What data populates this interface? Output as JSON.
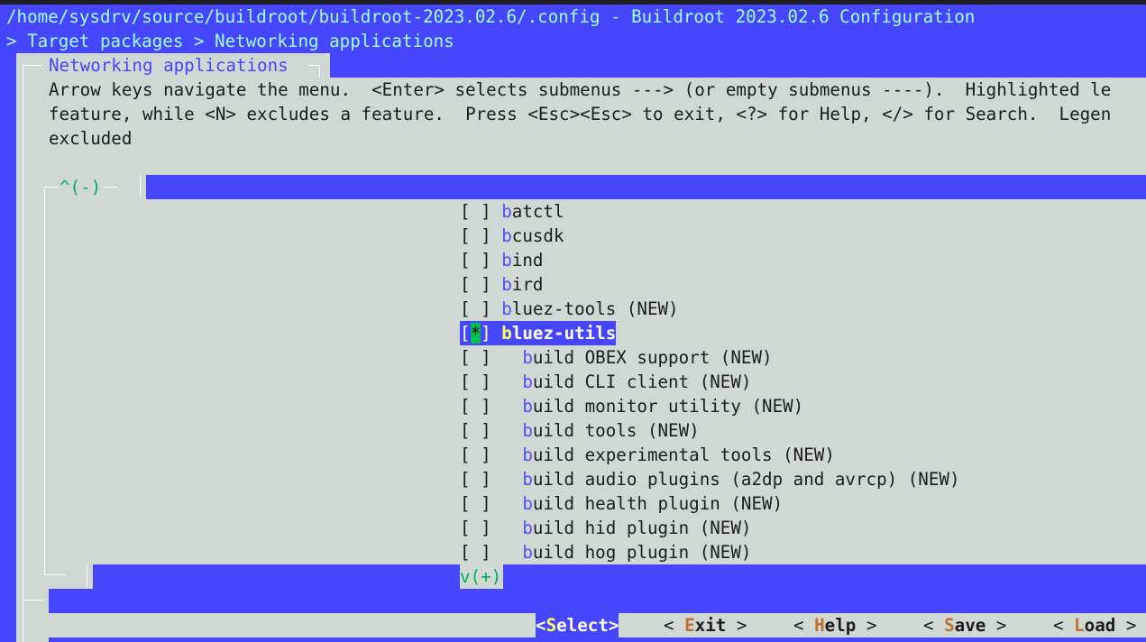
{
  "window": {
    "title": "/home/sysdrv/source/buildroot/buildroot-2023.02.6/.config - Buildroot 2023.02.6 Configuration",
    "breadcrumb": "> Target packages > Networking applications"
  },
  "dialog": {
    "title": "Networking applications",
    "help_lines": [
      "Arrow keys navigate the menu.  <Enter> selects submenus ---> (or empty submenus ----).  Highlighted le",
      "feature, while <N> excludes a feature.  Press <Esc><Esc> to exit, <?> for Help, </> for Search.  Legen",
      "excluded"
    ],
    "scroll_up": "^(-)",
    "scroll_down": "v(+)"
  },
  "menu": {
    "items": [
      {
        "box": "[ ]",
        "hot": "b",
        "rest": "atctl",
        "indent": false,
        "selected": false
      },
      {
        "box": "[ ]",
        "hot": "b",
        "rest": "cusdk",
        "indent": false,
        "selected": false
      },
      {
        "box": "[ ]",
        "hot": "b",
        "rest": "ind",
        "indent": false,
        "selected": false
      },
      {
        "box": "[ ]",
        "hot": "b",
        "rest": "ird",
        "indent": false,
        "selected": false
      },
      {
        "box": "[ ]",
        "hot": "b",
        "rest": "luez-tools (NEW)",
        "indent": false,
        "selected": false
      },
      {
        "box": "[*]",
        "hot": "b",
        "rest": "luez-utils",
        "indent": false,
        "selected": true
      },
      {
        "box": "[ ]",
        "hot": "b",
        "rest": "uild OBEX support (NEW)",
        "indent": true,
        "selected": false
      },
      {
        "box": "[ ]",
        "hot": "b",
        "rest": "uild CLI client (NEW)",
        "indent": true,
        "selected": false
      },
      {
        "box": "[ ]",
        "hot": "b",
        "rest": "uild monitor utility (NEW)",
        "indent": true,
        "selected": false
      },
      {
        "box": "[ ]",
        "hot": "b",
        "rest": "uild tools (NEW)",
        "indent": true,
        "selected": false
      },
      {
        "box": "[ ]",
        "hot": "b",
        "rest": "uild experimental tools (NEW)",
        "indent": true,
        "selected": false
      },
      {
        "box": "[ ]",
        "hot": "b",
        "rest": "uild audio plugins (a2dp and avrcp) (NEW)",
        "indent": true,
        "selected": false
      },
      {
        "box": "[ ]",
        "hot": "b",
        "rest": "uild health plugin (NEW)",
        "indent": true,
        "selected": false
      },
      {
        "box": "[ ]",
        "hot": "b",
        "rest": "uild hid plugin (NEW)",
        "indent": true,
        "selected": false
      },
      {
        "box": "[ ]",
        "hot": "b",
        "rest": "uild hog plugin (NEW)",
        "indent": true,
        "selected": false
      }
    ]
  },
  "buttons": [
    {
      "pre": "<",
      "key": "S",
      "rest": "elect",
      "post": ">",
      "selected": true
    },
    {
      "pre": "< ",
      "key": "E",
      "rest": "xit",
      "post": " >",
      "selected": false
    },
    {
      "pre": "< ",
      "key": "H",
      "rest": "elp",
      "post": " >",
      "selected": false
    },
    {
      "pre": "< ",
      "key": "S",
      "rest": "ave",
      "post": " >",
      "selected": false
    },
    {
      "pre": "< ",
      "key": "L",
      "rest": "oad",
      "post": " >",
      "selected": false
    }
  ]
}
